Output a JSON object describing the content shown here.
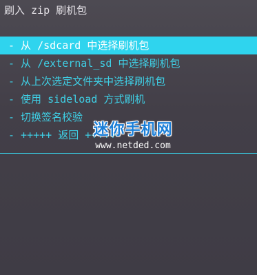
{
  "header": {
    "title": "刷入 zip 刷机包"
  },
  "menu": {
    "items": [
      {
        "label": "- 从 /sdcard 中选择刷机包",
        "selected": true
      },
      {
        "label": "- 从 /external_sd 中选择刷机包",
        "selected": false
      },
      {
        "label": "- 从上次选定文件夹中选择刷机包",
        "selected": false
      },
      {
        "label": "- 使用 sideload 方式刷机",
        "selected": false
      },
      {
        "label": "- 切换签名校验",
        "selected": false
      },
      {
        "label": "- +++++ 返回 +++++",
        "selected": false
      }
    ]
  },
  "watermark": {
    "name": "迷你手机网",
    "url": "www.netded.com"
  },
  "colors": {
    "background": "#46434a",
    "menu_text": "#3fd0e6",
    "highlight": "#2fd4ee",
    "title_text": "#e6e3e8"
  }
}
